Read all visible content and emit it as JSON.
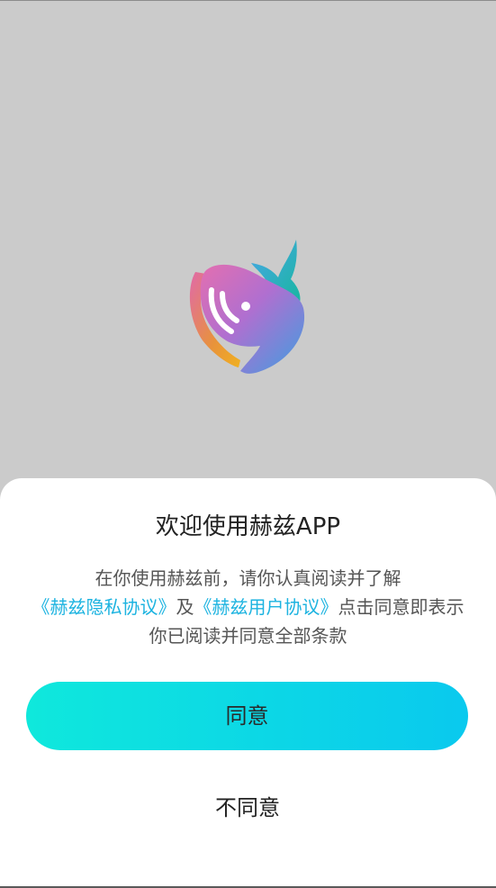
{
  "dialog": {
    "title": "欢迎使用赫兹APP",
    "desc_prefix": "在你使用赫兹前，请你认真阅读并了解",
    "privacy_link": "《赫兹隐私协议》",
    "and_text": "及",
    "user_link": "《赫兹用户协议》",
    "desc_suffix": "点击同意即表示你已阅读并同意全部条款",
    "agree_label": "同意",
    "disagree_label": "不同意"
  },
  "colors": {
    "link": "#1cb3e0",
    "button_gradient_start": "#0fe8dc",
    "button_gradient_end": "#0ac9ee",
    "backdrop": "#cbcbcb"
  },
  "logo": {
    "icon": "whale-logo-icon"
  }
}
